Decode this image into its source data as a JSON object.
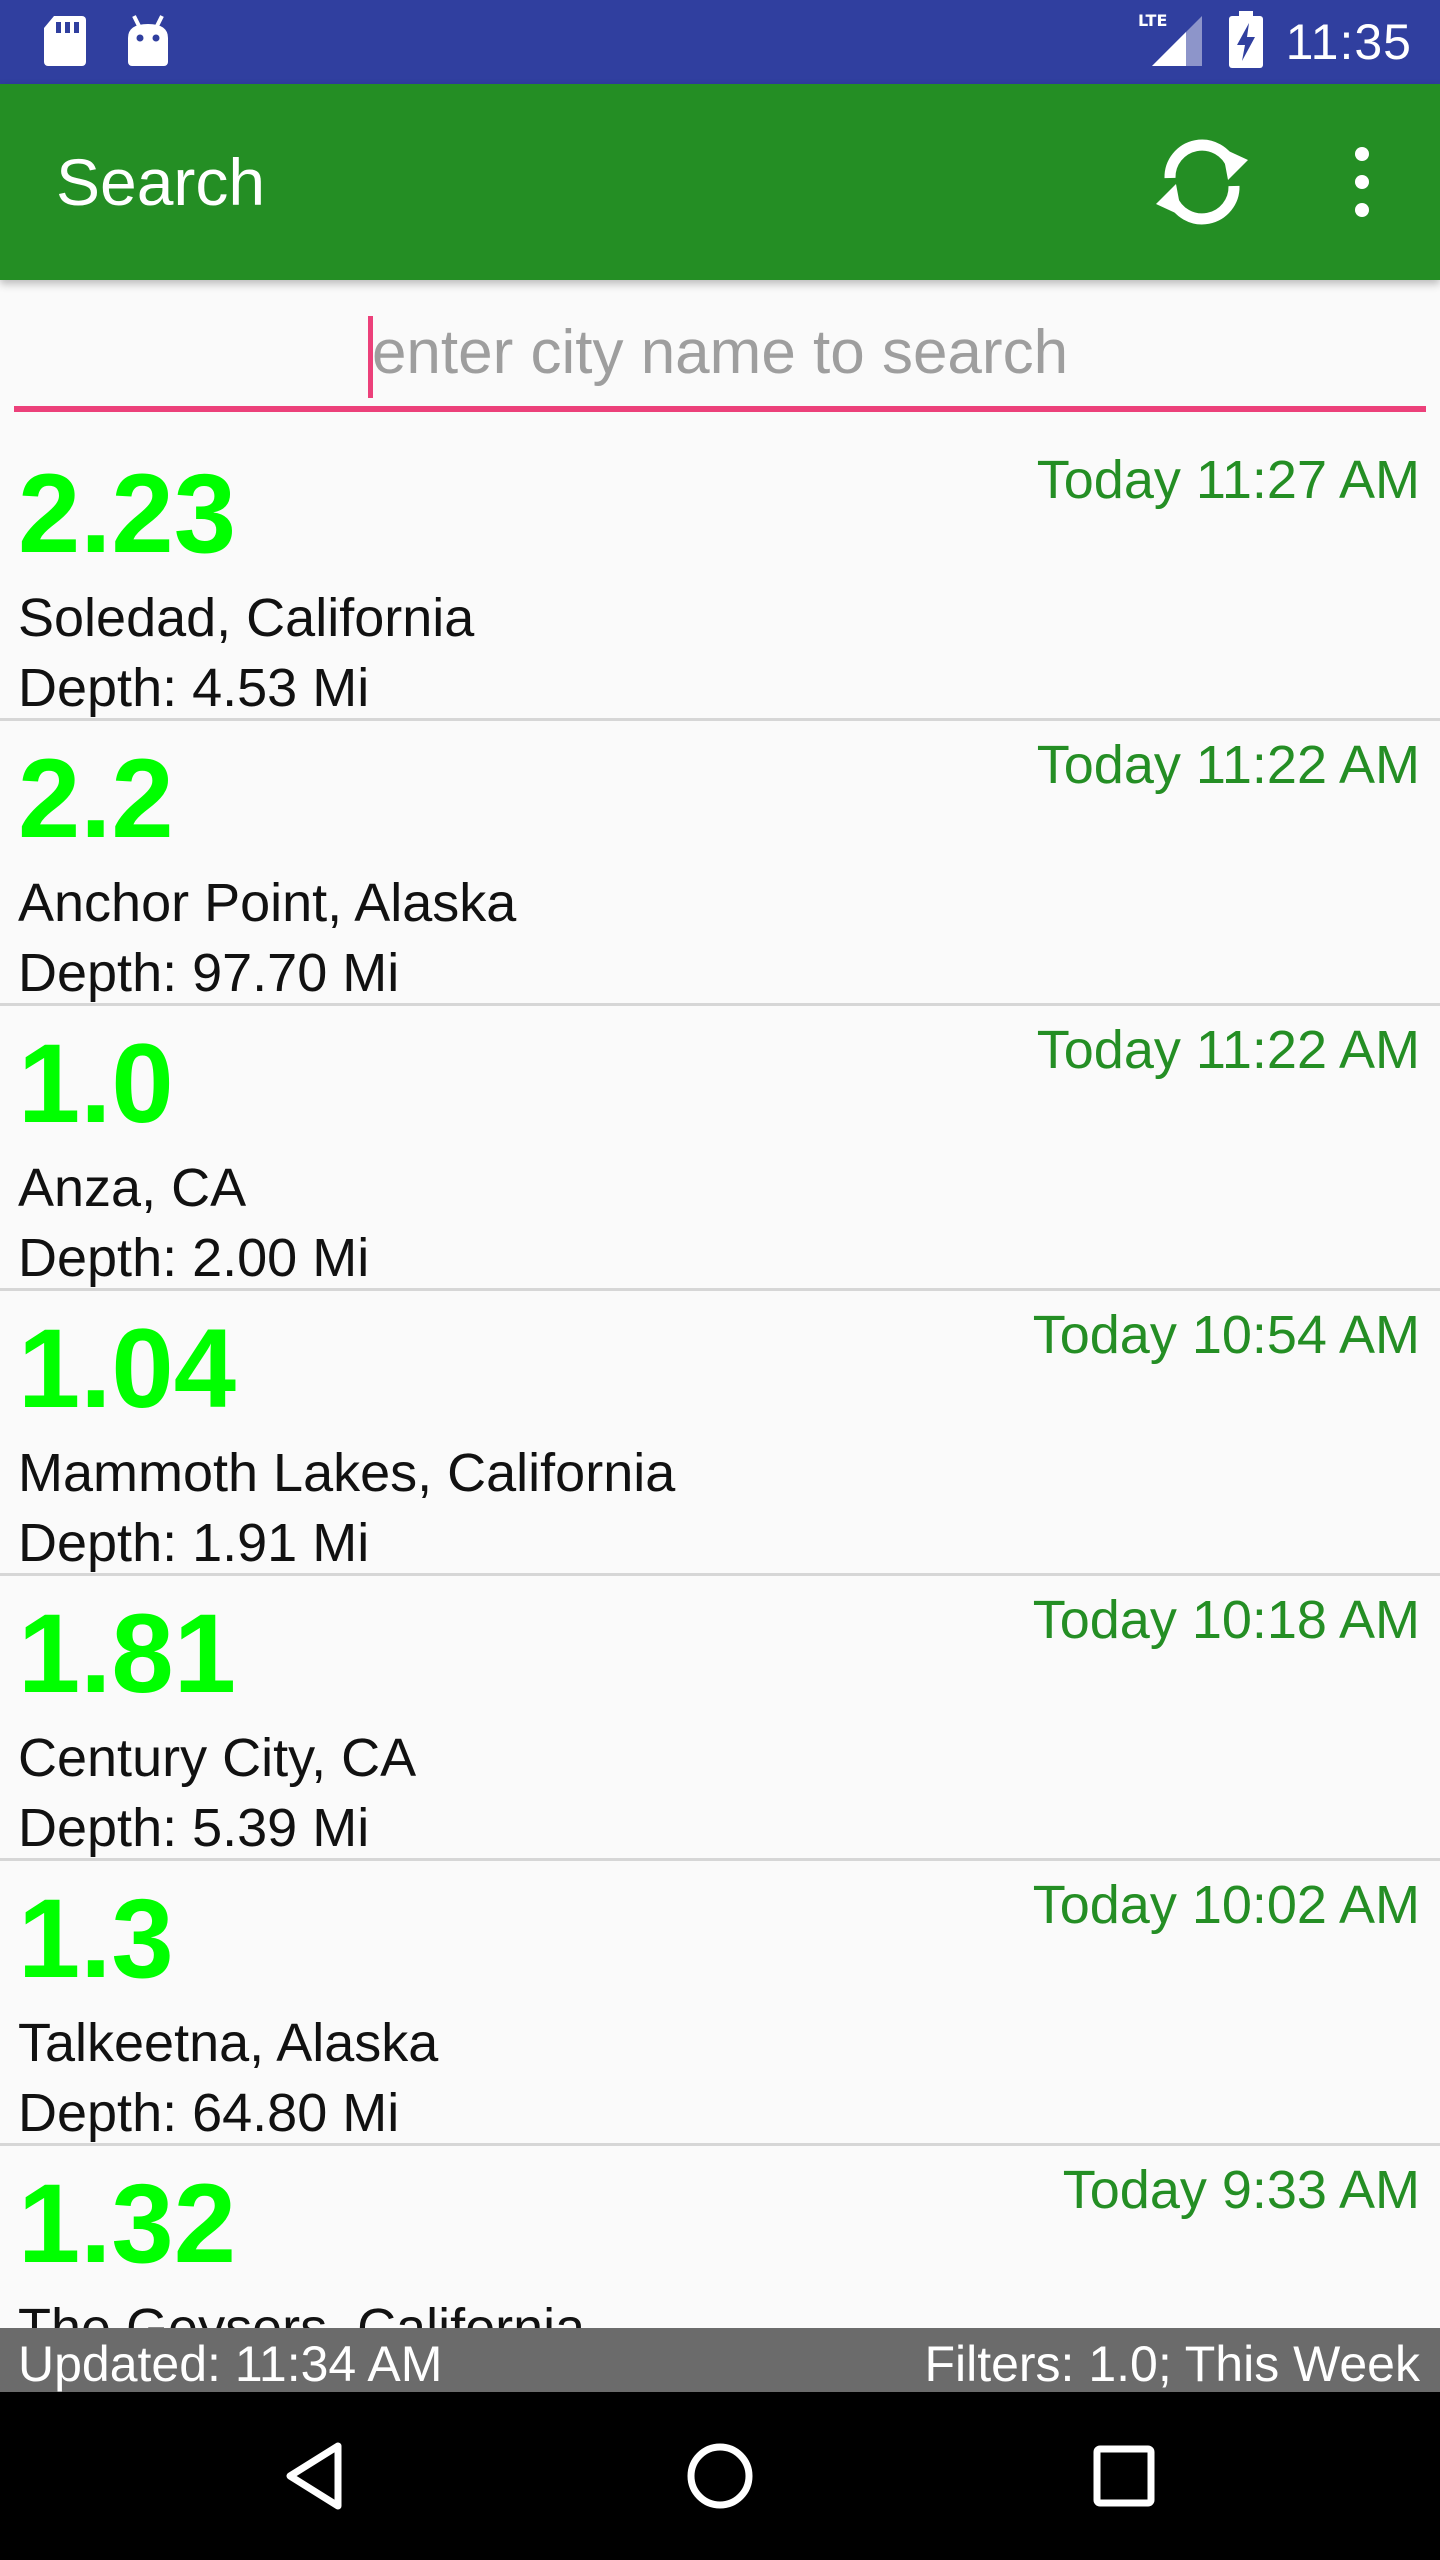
{
  "status_bar": {
    "network": "LTE",
    "time": "11:35",
    "icons": [
      "sd-card-icon",
      "android-icon",
      "lte-signal-icon",
      "battery-charging-icon"
    ]
  },
  "toolbar": {
    "title": "Search",
    "icons": [
      "refresh-icon",
      "more-vert-icon"
    ]
  },
  "search": {
    "placeholder": "enter city name to search",
    "value": ""
  },
  "quakes": [
    {
      "magnitude": "2.23",
      "place": "Soledad, California",
      "depth": "Depth: 4.53 Mi",
      "time": "Today 11:27 AM"
    },
    {
      "magnitude": "2.2",
      "place": "Anchor Point, Alaska",
      "depth": "Depth: 97.70 Mi",
      "time": "Today 11:22 AM"
    },
    {
      "magnitude": "1.0",
      "place": "Anza, CA",
      "depth": "Depth: 2.00 Mi",
      "time": "Today 11:22 AM"
    },
    {
      "magnitude": "1.04",
      "place": "Mammoth Lakes, California",
      "depth": "Depth: 1.91 Mi",
      "time": "Today 10:54 AM"
    },
    {
      "magnitude": "1.81",
      "place": "Century City, CA",
      "depth": "Depth: 5.39 Mi",
      "time": "Today 10:18 AM"
    },
    {
      "magnitude": "1.3",
      "place": "Talkeetna, Alaska",
      "depth": "Depth: 64.80 Mi",
      "time": "Today 10:02 AM"
    },
    {
      "magnitude": "1.32",
      "place": "The Geysers, California",
      "depth": "",
      "time": "Today 9:33 AM"
    }
  ],
  "footer": {
    "updated": "Updated: 11:34 AM",
    "filters": "Filters: 1.0; This Week"
  },
  "nav": {
    "icons": [
      "back-icon",
      "home-icon",
      "recents-icon"
    ]
  },
  "colors": {
    "status_bar": "#303F9F",
    "toolbar": "#248E24",
    "magnitude": "#00FF00",
    "time_text": "#248E24",
    "accent": "#EC407A",
    "footer": "#6B6B6B"
  }
}
